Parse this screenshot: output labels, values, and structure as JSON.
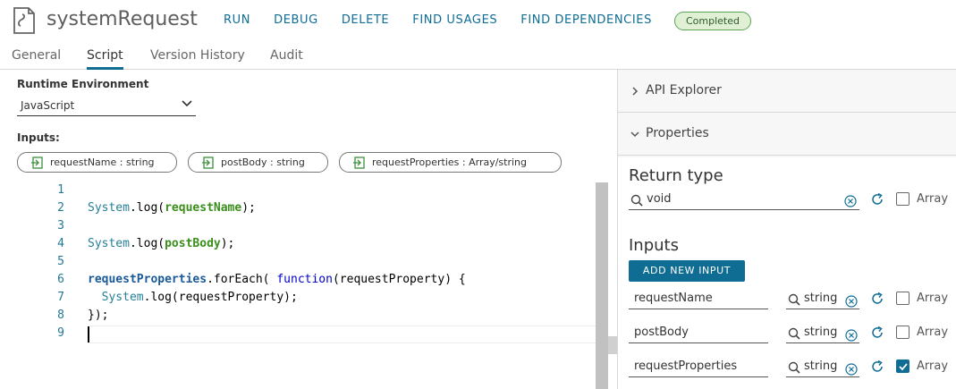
{
  "header": {
    "title": "systemRequest",
    "actions": [
      "RUN",
      "DEBUG",
      "DELETE",
      "FIND USAGES",
      "FIND DEPENDENCIES"
    ],
    "status": "Completed"
  },
  "tabs": [
    "General",
    "Script",
    "Version History",
    "Audit"
  ],
  "active_tab": "Script",
  "runtime": {
    "label": "Runtime Environment",
    "value": "JavaScript"
  },
  "inputs_section": {
    "label": "Inputs:",
    "chips": [
      "requestName : string",
      "postBody : string",
      "requestProperties : Array/string"
    ]
  },
  "editor": {
    "line_numbers": [
      "1",
      "2",
      "3",
      "4",
      "5",
      "6",
      "7",
      "8",
      "9"
    ],
    "lines": [
      [],
      [
        {
          "t": "System",
          "c": "obj"
        },
        {
          "t": ".log(",
          "c": ""
        },
        {
          "t": "requestName",
          "c": "arg"
        },
        {
          "t": ");",
          "c": ""
        }
      ],
      [],
      [
        {
          "t": "System",
          "c": "obj"
        },
        {
          "t": ".log(",
          "c": ""
        },
        {
          "t": "postBody",
          "c": "arg"
        },
        {
          "t": ");",
          "c": ""
        }
      ],
      [],
      [
        {
          "t": "requestProperties",
          "c": "var"
        },
        {
          "t": ".forEach( ",
          "c": ""
        },
        {
          "t": "function",
          "c": "kw"
        },
        {
          "t": "(requestProperty) {",
          "c": ""
        }
      ],
      [
        {
          "t": "  ",
          "c": ""
        },
        {
          "t": "System",
          "c": "obj"
        },
        {
          "t": ".log(requestProperty);",
          "c": ""
        }
      ],
      [
        {
          "t": "});",
          "c": ""
        }
      ],
      []
    ]
  },
  "right_panel": {
    "api_explorer": "API Explorer",
    "properties": "Properties",
    "return_type_heading": "Return type",
    "return_type_value": "void",
    "array_label": "Array",
    "inputs_heading": "Inputs",
    "add_input_label": "ADD NEW INPUT",
    "inputs": [
      {
        "name": "requestName",
        "type": "string",
        "array": false
      },
      {
        "name": "postBody",
        "type": "string",
        "array": false
      },
      {
        "name": "requestProperties",
        "type": "string",
        "array": true
      }
    ]
  },
  "colors": {
    "accent": "#0f6d94",
    "status_bg": "#dff0d5",
    "status_border": "#5ea35a"
  },
  "icons": [
    "document-icon",
    "chevron-down-icon",
    "input-arrow-icon",
    "chevron-right-icon",
    "search-icon",
    "clear-icon",
    "refresh-icon",
    "check-icon"
  ]
}
